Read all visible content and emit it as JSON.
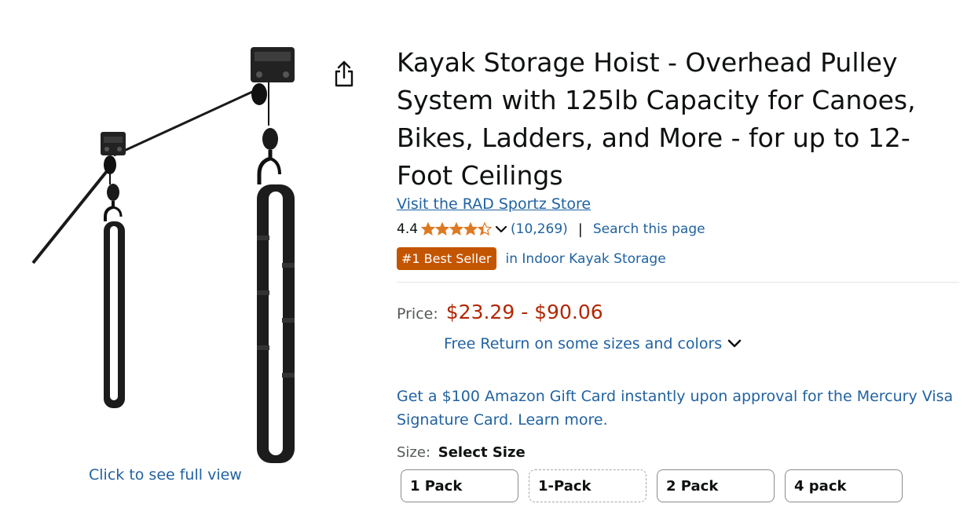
{
  "gallery": {
    "full_view_link": "Click to see full view",
    "image_icon": "kayak-hoist-product-image"
  },
  "share": {
    "icon": "share-icon"
  },
  "product": {
    "title": "Kayak Storage Hoist - Overhead Pulley System with 125lb Capacity for Canoes, Bikes, Ladders, and More - for up to 12-Foot Ceilings",
    "store_link": "Visit the RAD Sportz Store",
    "rating": "4.4",
    "stars_filled": 4.4,
    "review_count": "(10,269)",
    "separator": "|",
    "search_page": "Search this page",
    "best_seller_badge": "#1 Best Seller",
    "best_seller_category": "in Indoor Kayak Storage"
  },
  "pricing": {
    "label": "Price:",
    "range": "$23.29 - $90.06",
    "free_return": "Free Return on some sizes and colors"
  },
  "promo": {
    "gift_card": "Get a $100 Amazon Gift Card instantly upon approval for the Mercury Visa Signature Card. Learn more."
  },
  "size": {
    "label": "Size:",
    "selected": "Select Size",
    "options": [
      "1 Pack",
      "1-Pack",
      "2 Pack",
      "4 pack"
    ]
  },
  "colors": {
    "link": "#2162a1",
    "price": "#b12704",
    "badge": "#c45500",
    "star": "#de7921"
  }
}
